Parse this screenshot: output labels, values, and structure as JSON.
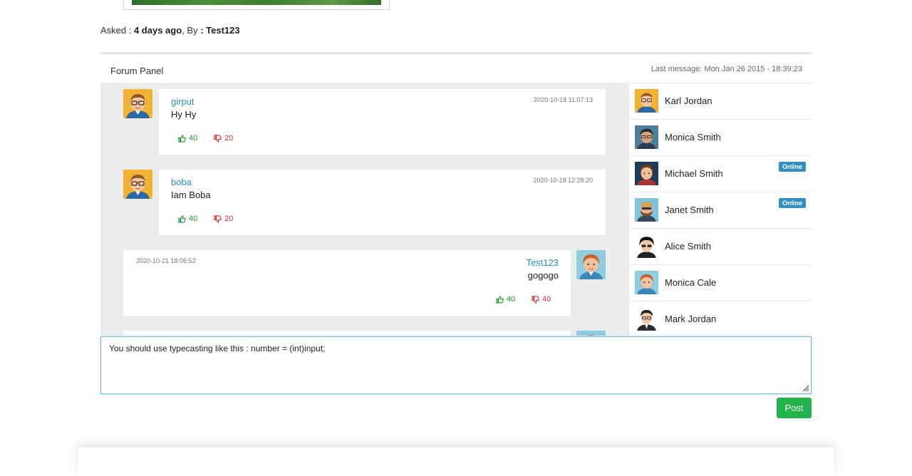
{
  "question_meta": {
    "asked_prefix": "Asked : ",
    "asked_when": "4 days ago",
    "by_prefix": ", By ",
    "by_user": ": Test123"
  },
  "forum_panel": {
    "title": "Forum Panel",
    "last_message": "Last message: Mon Jan 26 2015 - 18:39:23"
  },
  "messages": [
    {
      "author": "girput",
      "text": "Hy Hy",
      "timestamp": "2020-10-18 11:07:13",
      "likes": "40",
      "dislikes": "20",
      "side": "left",
      "avatar": "avatar-glasses-man"
    },
    {
      "author": "boba",
      "text": "Iam Boba",
      "timestamp": "2020-10-18 12:28:20",
      "likes": "40",
      "dislikes": "20",
      "side": "left",
      "avatar": "avatar-glasses-man"
    },
    {
      "author": "Test123",
      "text": "gogogo",
      "timestamp": "2020-10-21 18:06:52",
      "likes": "40",
      "dislikes": "40",
      "side": "right",
      "avatar": "avatar-redhead-man"
    }
  ],
  "contacts": [
    {
      "name": "Karl Jordan",
      "status": "",
      "avatar": "avatar-glasses-man"
    },
    {
      "name": "Monica Smith",
      "status": "",
      "avatar": "avatar-dark-hair-man"
    },
    {
      "name": "Michael Smith",
      "status": "Online",
      "avatar": "avatar-brown-hair-man"
    },
    {
      "name": "Janet Smith",
      "status": "Online",
      "avatar": "avatar-bearded-man"
    },
    {
      "name": "Alice Smith",
      "status": "",
      "avatar": "avatar-black-hair-man"
    },
    {
      "name": "Monica Cale",
      "status": "",
      "avatar": "avatar-redhead-man"
    },
    {
      "name": "Mark Jordan",
      "status": "",
      "avatar": "avatar-suit-man"
    }
  ],
  "reply": {
    "value": "You should use typecasting like this : number = (int)input; "
  },
  "post_button": {
    "label": "Post"
  },
  "colors": {
    "link_blue": "#2a8ec4",
    "like_green": "#1c9a2c",
    "dislike_red": "#d22d2d",
    "online_badge": "#2f8fc6",
    "post_green": "#22b34b",
    "chat_background": "#ececec"
  }
}
